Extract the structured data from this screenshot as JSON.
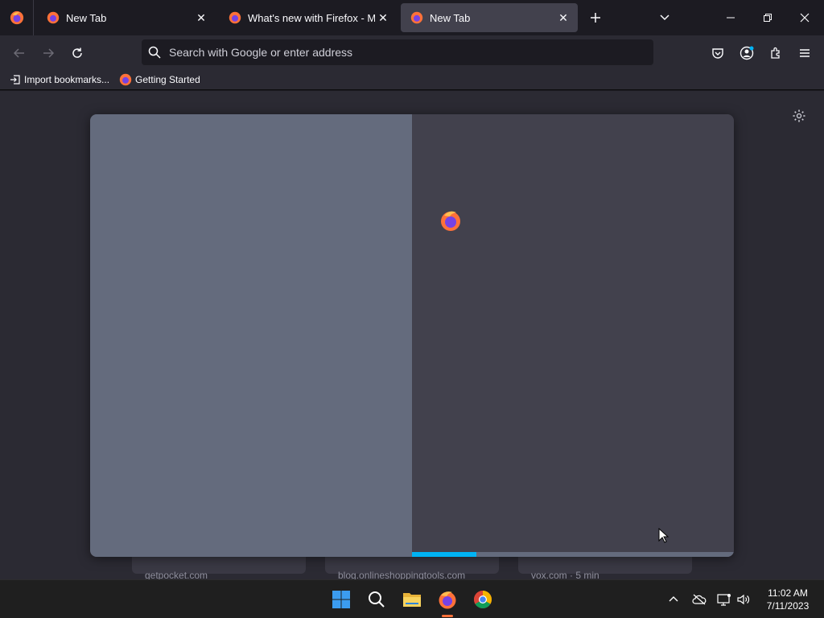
{
  "tabs": [
    {
      "title": "New Tab",
      "active": false
    },
    {
      "title": "What's new with Firefox - More",
      "active": false
    },
    {
      "title": "New Tab",
      "active": true
    }
  ],
  "urlbar": {
    "placeholder": "Search with Google or enter address",
    "value": ""
  },
  "bookmarks": [
    {
      "label": "Import bookmarks..."
    },
    {
      "label": "Getting Started"
    }
  ],
  "top_sites": [
    {
      "label": "getpocket.com"
    },
    {
      "label": "blog.onlineshoppingtools.com"
    },
    {
      "label": "vox.com · 5 min"
    }
  ],
  "onboarding": {
    "progress": 0.2
  },
  "clock": {
    "time": "11:02 AM",
    "date": "7/11/2023"
  },
  "colors": {
    "accent": "#00b3f4",
    "firefox_orange": "#ff7139",
    "modal_left": "#646b7d",
    "modal_right": "#42414d"
  }
}
